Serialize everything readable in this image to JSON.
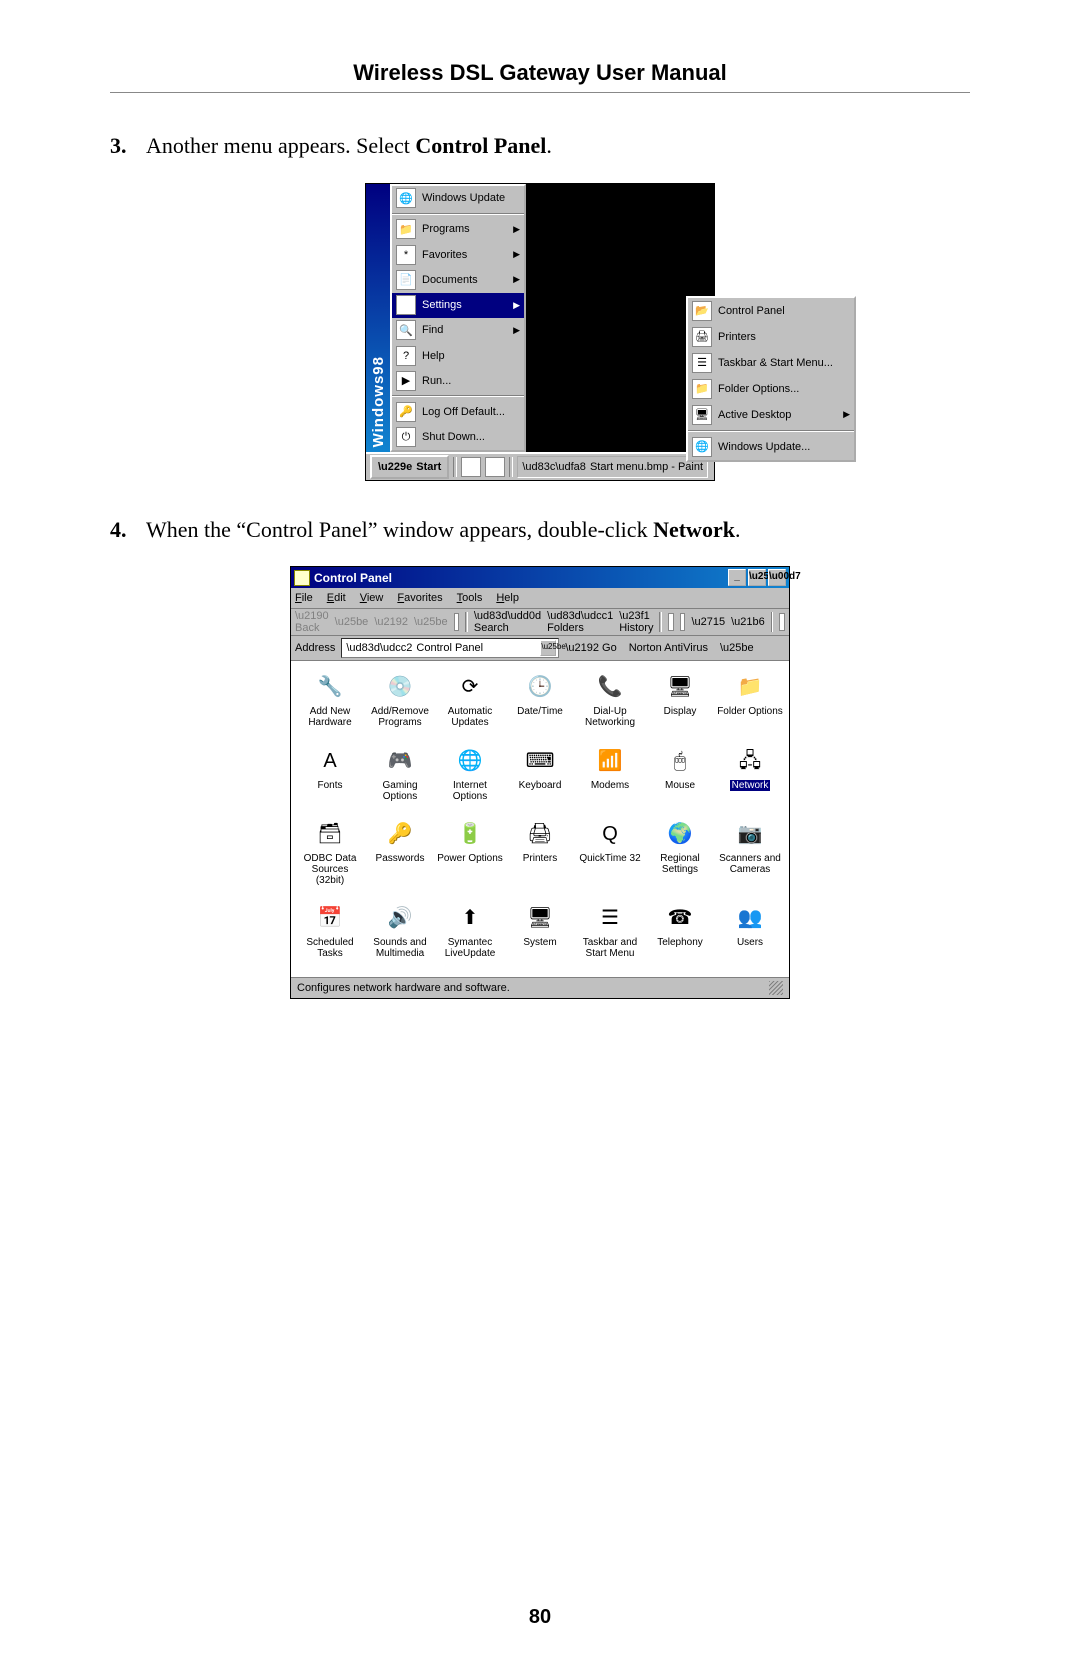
{
  "header": "Wireless DSL Gateway User Manual",
  "page_number": "80",
  "steps": [
    {
      "num": "3.",
      "pre": "Another menu appears. Select ",
      "bold": "Control Panel",
      "post": "."
    },
    {
      "num": "4.",
      "pre": "When the “Control Panel” window appears, double-click ",
      "bold": "Network",
      "post": "."
    }
  ],
  "start_menu": {
    "sidebar": "Windows98",
    "items": [
      {
        "label": "Windows Update",
        "arrow": false,
        "hl": false,
        "gfx": "🌐"
      },
      {
        "sep": true
      },
      {
        "label": "Programs",
        "arrow": true,
        "hl": false,
        "gfx": "📁"
      },
      {
        "label": "Favorites",
        "arrow": true,
        "hl": false,
        "gfx": "*"
      },
      {
        "label": "Documents",
        "arrow": true,
        "hl": false,
        "gfx": "📄"
      },
      {
        "label": "Settings",
        "arrow": true,
        "hl": true,
        "gfx": "⚙"
      },
      {
        "label": "Find",
        "arrow": true,
        "hl": false,
        "gfx": "🔍"
      },
      {
        "label": "Help",
        "arrow": false,
        "hl": false,
        "gfx": "?"
      },
      {
        "label": "Run...",
        "arrow": false,
        "hl": false,
        "gfx": "▶"
      },
      {
        "sep": true
      },
      {
        "label": "Log Off Default...",
        "arrow": false,
        "hl": false,
        "gfx": "🔑"
      },
      {
        "label": "Shut Down...",
        "arrow": false,
        "hl": false,
        "gfx": "⏻"
      }
    ],
    "submenu": [
      {
        "label": "Control Panel",
        "arrow": false,
        "gfx": "📂"
      },
      {
        "label": "Printers",
        "arrow": false,
        "gfx": "🖨"
      },
      {
        "label": "Taskbar & Start Menu...",
        "arrow": false,
        "gfx": "☰"
      },
      {
        "label": "Folder Options...",
        "arrow": false,
        "gfx": "📁"
      },
      {
        "label": "Active Desktop",
        "arrow": true,
        "gfx": "🖥"
      },
      {
        "sep": true
      },
      {
        "label": "Windows Update...",
        "arrow": false,
        "gfx": "🌐"
      }
    ],
    "taskbar": {
      "start": "Start",
      "task": "Start menu.bmp - Paint"
    }
  },
  "control_panel": {
    "title": "Control Panel",
    "menus": [
      "File",
      "Edit",
      "View",
      "Favorites",
      "Tools",
      "Help"
    ],
    "toolbar": {
      "back": "Back",
      "search": "Search",
      "folders": "Folders",
      "history": "History"
    },
    "address": {
      "label": "Address",
      "value": "Control Panel",
      "go": "Go",
      "nav": "Norton AntiVirus"
    },
    "icons": [
      {
        "l1": "Add New",
        "l2": "Hardware",
        "g": "🔧"
      },
      {
        "l1": "Add/Remove",
        "l2": "Programs",
        "g": "💿"
      },
      {
        "l1": "Automatic",
        "l2": "Updates",
        "g": "⟳"
      },
      {
        "l1": "Date/Time",
        "l2": "",
        "g": "🕒"
      },
      {
        "l1": "Dial-Up",
        "l2": "Networking",
        "g": "📞"
      },
      {
        "l1": "Display",
        "l2": "",
        "g": "🖥"
      },
      {
        "l1": "Folder Options",
        "l2": "",
        "g": "📁"
      },
      {
        "l1": "Fonts",
        "l2": "",
        "g": "A"
      },
      {
        "l1": "Gaming",
        "l2": "Options",
        "g": "🎮"
      },
      {
        "l1": "Internet",
        "l2": "Options",
        "g": "🌐"
      },
      {
        "l1": "Keyboard",
        "l2": "",
        "g": "⌨"
      },
      {
        "l1": "Modems",
        "l2": "",
        "g": "📶"
      },
      {
        "l1": "Mouse",
        "l2": "",
        "g": "🖱"
      },
      {
        "l1": "Network",
        "l2": "",
        "g": "🖧",
        "sel": true
      },
      {
        "l1": "ODBC Data",
        "l2": "Sources (32bit)",
        "g": "🗃"
      },
      {
        "l1": "Passwords",
        "l2": "",
        "g": "🔑"
      },
      {
        "l1": "Power Options",
        "l2": "",
        "g": "🔋"
      },
      {
        "l1": "Printers",
        "l2": "",
        "g": "🖨"
      },
      {
        "l1": "QuickTime 32",
        "l2": "",
        "g": "Q"
      },
      {
        "l1": "Regional",
        "l2": "Settings",
        "g": "🌍"
      },
      {
        "l1": "Scanners and",
        "l2": "Cameras",
        "g": "📷"
      },
      {
        "l1": "Scheduled",
        "l2": "Tasks",
        "g": "📅"
      },
      {
        "l1": "Sounds and",
        "l2": "Multimedia",
        "g": "🔊"
      },
      {
        "l1": "Symantec",
        "l2": "LiveUpdate",
        "g": "⬆"
      },
      {
        "l1": "System",
        "l2": "",
        "g": "🖥"
      },
      {
        "l1": "Taskbar and",
        "l2": "Start Menu",
        "g": "☰"
      },
      {
        "l1": "Telephony",
        "l2": "",
        "g": "☎"
      },
      {
        "l1": "Users",
        "l2": "",
        "g": "👥"
      }
    ],
    "status": "Configures network hardware and software."
  }
}
